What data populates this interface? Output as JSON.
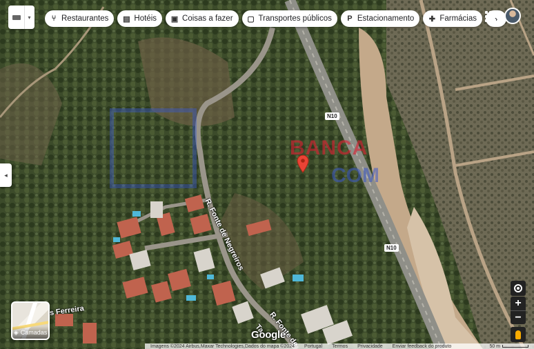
{
  "chips": [
    {
      "icon": "cutlery-icon",
      "glyph": "⑂",
      "label": "Restaurantes"
    },
    {
      "icon": "bed-icon",
      "glyph": "▤",
      "label": "Hotéis"
    },
    {
      "icon": "camera-icon",
      "glyph": "▣",
      "label": "Coisas a fazer"
    },
    {
      "icon": "bus-icon",
      "glyph": "▢",
      "label": "Transportes públicos"
    },
    {
      "icon": "parking-icon",
      "glyph": "P",
      "label": "Estacionamento"
    },
    {
      "icon": "pharmacy-icon",
      "glyph": "✚",
      "label": "Farmácias"
    }
  ],
  "chips_more_glyph": "›",
  "map": {
    "road_labels": [
      "N10",
      "N10"
    ],
    "street_labels": [
      "R. Fonte de Negreiros",
      "R. Fonte de",
      "as Ferreira",
      "Ta"
    ],
    "watermark_top": "BANCA",
    "watermark_bottom": "COM",
    "pin_color": "#ea4335"
  },
  "layers": {
    "label": "Camadas"
  },
  "google_logo": "Google",
  "footer": {
    "attribution": "Imagens ©2024 Airbus,Maxar Technologies,Dados do mapa ©2024",
    "links": [
      "Portugal",
      "Termos",
      "Privacidade",
      "Enviar feedback do produto"
    ],
    "scale": "50 m"
  },
  "controls": {
    "zoom_in": "+",
    "zoom_out": "−",
    "sidebar_toggle": "◂"
  }
}
